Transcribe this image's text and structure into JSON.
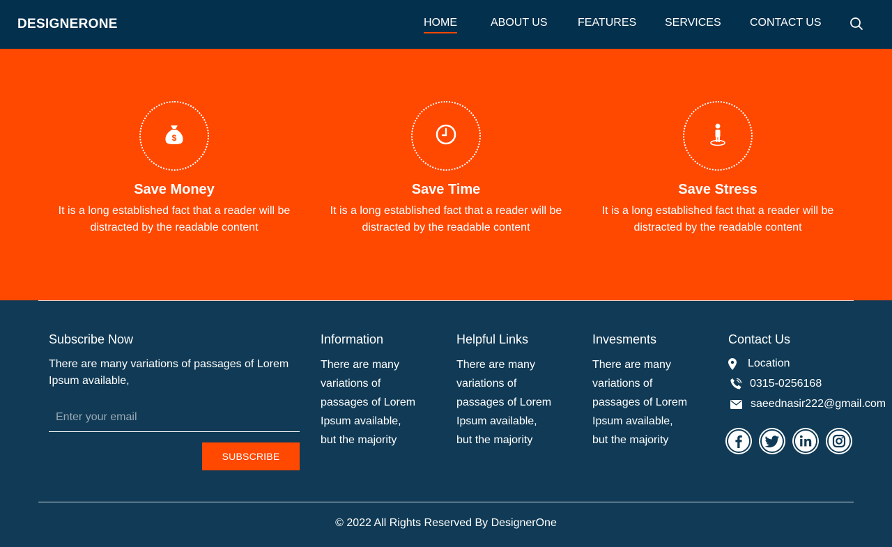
{
  "header": {
    "logo": "DESIGNERONE",
    "nav": [
      "HOME",
      "ABOUT US",
      "FEATURES",
      "SERVICES",
      "CONTACT US"
    ],
    "active_nav": "HOME",
    "search_icon": "search-icon"
  },
  "features": [
    {
      "icon": "money-bag-icon",
      "title": "Save Money",
      "text": "It is a long established fact that a reader will be distracted by the readable content"
    },
    {
      "icon": "clock-icon",
      "title": "Save Time",
      "text": "It is a long established fact that a reader will be distracted by the readable content"
    },
    {
      "icon": "person-icon",
      "title": "Save Stress",
      "text": "It is a long established fact that a reader will be distracted by the readable content"
    }
  ],
  "footer": {
    "subscribe": {
      "title": "Subscribe Now",
      "text": "There are many variations of passages of Lorem Ipsum available,",
      "placeholder": "Enter your email",
      "button": "SUBSCRIBE"
    },
    "columns": [
      {
        "title": "Information",
        "lines": [
          "There are many",
          "variations of",
          "passages of Lorem",
          "Ipsum available,",
          "but the majority"
        ]
      },
      {
        "title": "Helpful Links",
        "lines": [
          "There are many",
          "variations of",
          "passages of Lorem",
          "Ipsum available,",
          "but the majority"
        ]
      },
      {
        "title": "Invesments",
        "lines": [
          "There are many",
          "variations of",
          "passages of Lorem",
          "Ipsum available,",
          "but the majority"
        ]
      }
    ],
    "contact": {
      "title": "Contact Us",
      "location": "Location",
      "phone": "0315-0256168",
      "email": "saeednasir222@gmail.com",
      "social": [
        "facebook-icon",
        "twitter-icon",
        "linkedin-icon",
        "instagram-icon"
      ]
    },
    "copyright": "© 2022 All Rights Reserved By DesignerOne"
  },
  "colors": {
    "header_bg": "#03304d",
    "accent": "#ff4800",
    "footer_bg": "#103a55"
  }
}
